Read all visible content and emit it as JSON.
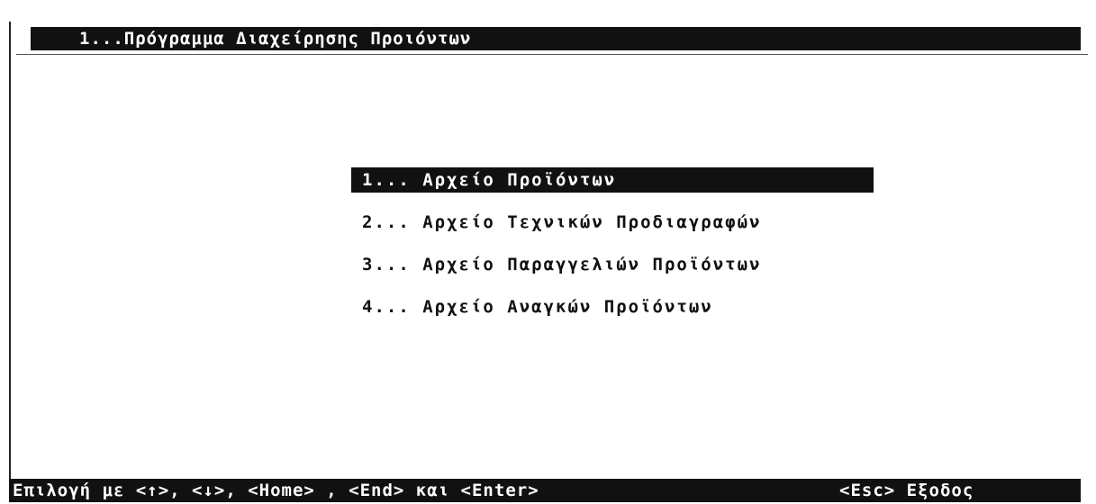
{
  "window": {
    "title": "1...Πρόγραμμα Διαχείρησης Προιόντων"
  },
  "menu": {
    "selected_index": 0,
    "items": [
      {
        "label": "1... Αρχείο Προϊόντων"
      },
      {
        "label": "2... Αρχείο Τεχνικών Προδιαγραφών"
      },
      {
        "label": "3... Αρχείο Παραγγελιών Προϊόντων"
      },
      {
        "label": "4... Αρχείο Αναγκών Προϊόντων"
      }
    ]
  },
  "status_bar": {
    "navigation_hint": "Επιλογή με <↑>, <↓>, <Home> , <End> και <Enter>",
    "exit_hint": "<Esc> Εξοδος"
  },
  "colors": {
    "background": "#ffffff",
    "bar_background": "#111111",
    "bar_text": "#ffffff",
    "text": "#111111"
  }
}
